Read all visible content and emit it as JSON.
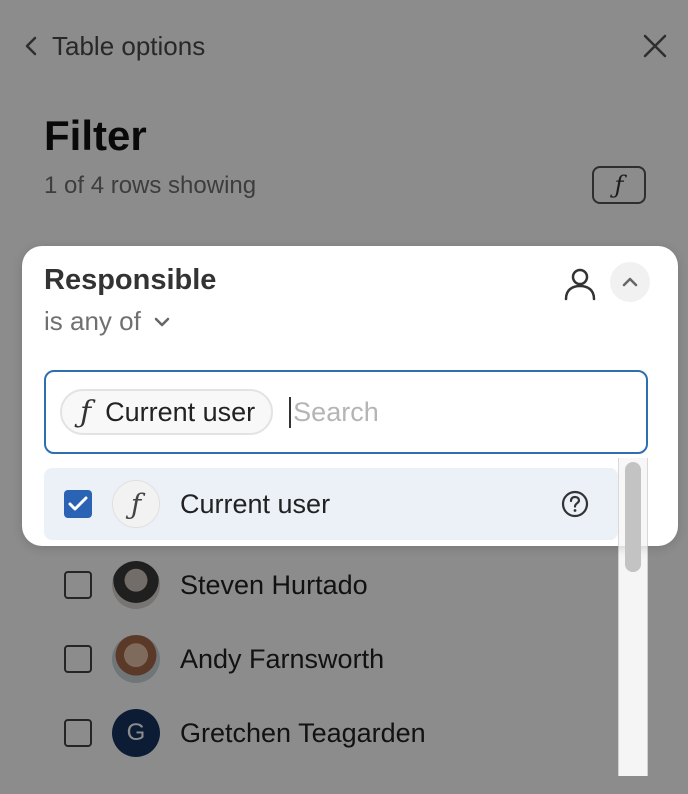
{
  "header": {
    "back_label": "Table options"
  },
  "filter": {
    "title": "Filter",
    "rows_showing": "1 of 4 rows showing",
    "formula_symbol": "ƒ"
  },
  "popover": {
    "field_name": "Responsible",
    "operator": "is any of",
    "chip_label": "Current user",
    "chip_symbol": "ƒ",
    "search_placeholder": "Search",
    "selected_option": {
      "label": "Current user",
      "symbol": "ƒ",
      "checked": true
    }
  },
  "options": [
    {
      "label": "Steven Hurtado",
      "checked": false,
      "avatar": "photo"
    },
    {
      "label": "Andy Farnsworth",
      "checked": false,
      "avatar": "photo"
    },
    {
      "label": "Gretchen Teagarden",
      "checked": false,
      "avatar": "initial",
      "initial": "G"
    }
  ],
  "colors": {
    "accent": "#2b63b4",
    "focus_border": "#2f6fb0",
    "selected_row_bg": "#ebf1f6",
    "avatar_initial_bg": "#16345f"
  },
  "icons": {
    "back": "chevron-left-icon",
    "close": "close-icon",
    "formula": "function-icon",
    "person": "person-icon",
    "collapse": "chevron-up-icon",
    "operator_dropdown": "chevron-down-icon",
    "help": "help-icon",
    "check": "checkmark-icon"
  }
}
